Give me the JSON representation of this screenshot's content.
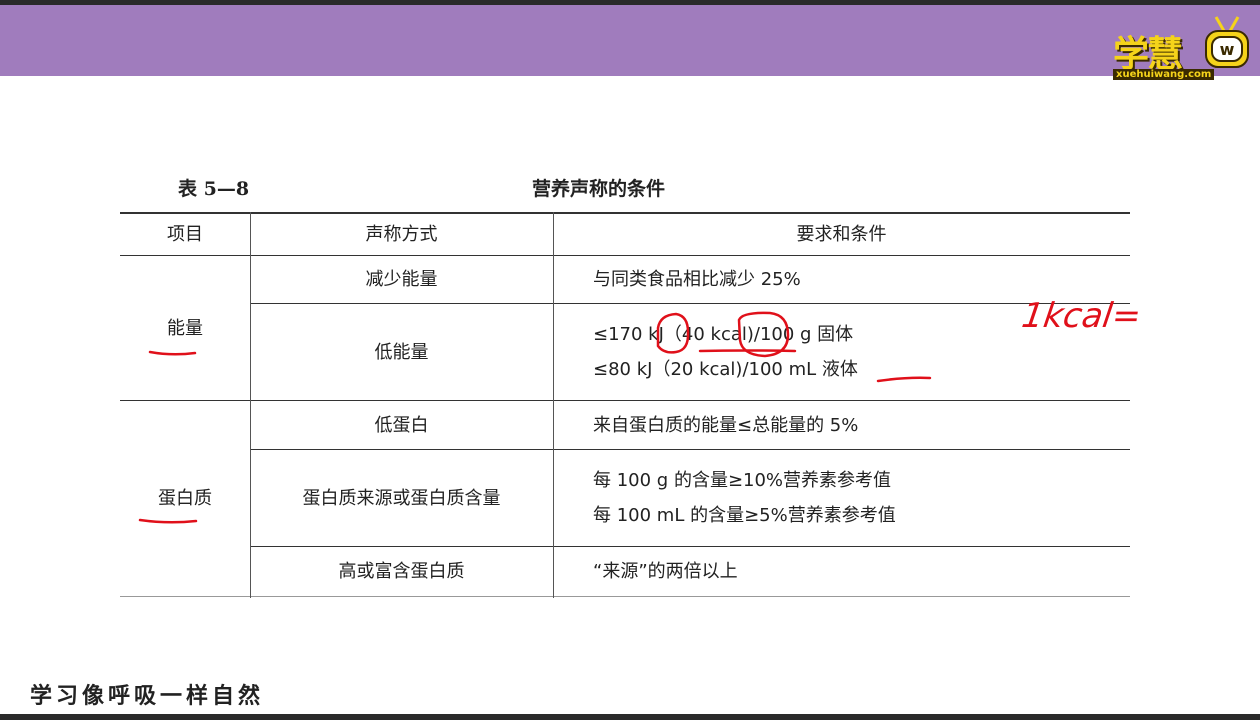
{
  "logo": {
    "text": "学慧",
    "url": "xuehuiwang.com"
  },
  "caption": {
    "number": "表 5—8",
    "title": "营养声称的条件"
  },
  "table": {
    "headers": [
      "项目",
      "声称方式",
      "要求和条件"
    ],
    "groups": [
      {
        "item": "能量",
        "rows": [
          {
            "method": "减少能量",
            "conditions": [
              "与同类食品相比减少 25%"
            ]
          },
          {
            "method": "低能量",
            "conditions": [
              "≤170 kJ（40 kcal)/100 g 固体",
              "≤80 kJ（20 kcal)/100 mL 液体"
            ]
          }
        ]
      },
      {
        "item": "蛋白质",
        "rows": [
          {
            "method": "低蛋白",
            "conditions": [
              "来自蛋白质的能量≤总能量的 5%"
            ]
          },
          {
            "method": "蛋白质来源或蛋白质含量",
            "conditions": [
              "每 100 g 的含量≥10%营养素参考值",
              "每 100 mL 的含量≥5%营养素参考值"
            ]
          },
          {
            "method": "高或富含蛋白质",
            "conditions": [
              "“来源”的两倍以上"
            ]
          }
        ]
      }
    ]
  },
  "annotation": "1kcal=",
  "annotation_color": "#e0101a",
  "banner_color": "#a07cbd",
  "footer": "学习像呼吸一样自然"
}
